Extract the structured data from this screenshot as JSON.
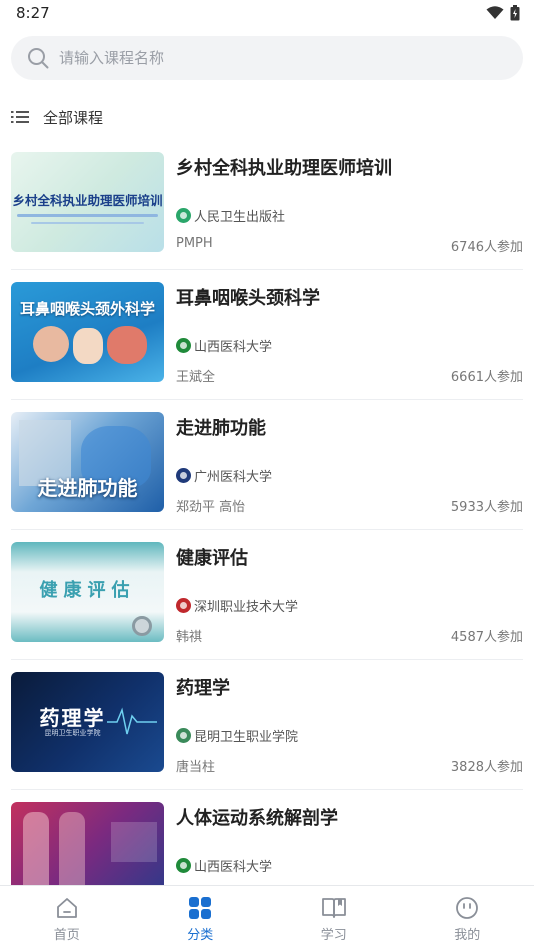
{
  "status_bar": {
    "time": "8:27"
  },
  "search": {
    "placeholder": "请输入课程名称"
  },
  "category": {
    "label": "全部课程"
  },
  "courses": [
    {
      "title": "乡村全科执业助理医师培训",
      "school": "人民卫生出版社",
      "teacher": "PMPH",
      "participants": "6746人参加",
      "thumb_text": "乡村全科执业助理医师培训",
      "logo_color": "#2aa66a"
    },
    {
      "title": "耳鼻咽喉头颈科学",
      "school": "山西医科大学",
      "teacher": "王斌全",
      "participants": "6661人参加",
      "thumb_text": "耳鼻咽喉头颈外科学",
      "logo_color": "#1f8a3a"
    },
    {
      "title": "走进肺功能",
      "school": "广州医科大学",
      "teacher": "郑劲平 高怡",
      "participants": "5933人参加",
      "thumb_text": "走进肺功能",
      "logo_color": "#1f3a7a"
    },
    {
      "title": "健康评估",
      "school": "深圳职业技术大学",
      "teacher": "韩祺",
      "participants": "4587人参加",
      "thumb_text": "健康评估",
      "logo_color": "#c0282d"
    },
    {
      "title": "药理学",
      "school": "昆明卫生职业学院",
      "teacher": "唐当柱",
      "participants": "3828人参加",
      "thumb_text": "药理学",
      "thumb_sub": "昆明卫生职业学院",
      "logo_color": "#3a8a5a"
    },
    {
      "title": "人体运动系统解剖学",
      "school": "山西医科大学",
      "teacher": "",
      "participants": "",
      "thumb_text": "",
      "logo_color": "#1f8a3a"
    }
  ],
  "nav": [
    {
      "label": "首页",
      "icon": "home-icon",
      "active": false
    },
    {
      "label": "分类",
      "icon": "category-grid-icon",
      "active": true
    },
    {
      "label": "学习",
      "icon": "book-icon",
      "active": false
    },
    {
      "label": "我的",
      "icon": "smile-face-icon",
      "active": false
    }
  ],
  "colors": {
    "accent": "#1a6fd0",
    "inactive": "#8a8f98"
  }
}
